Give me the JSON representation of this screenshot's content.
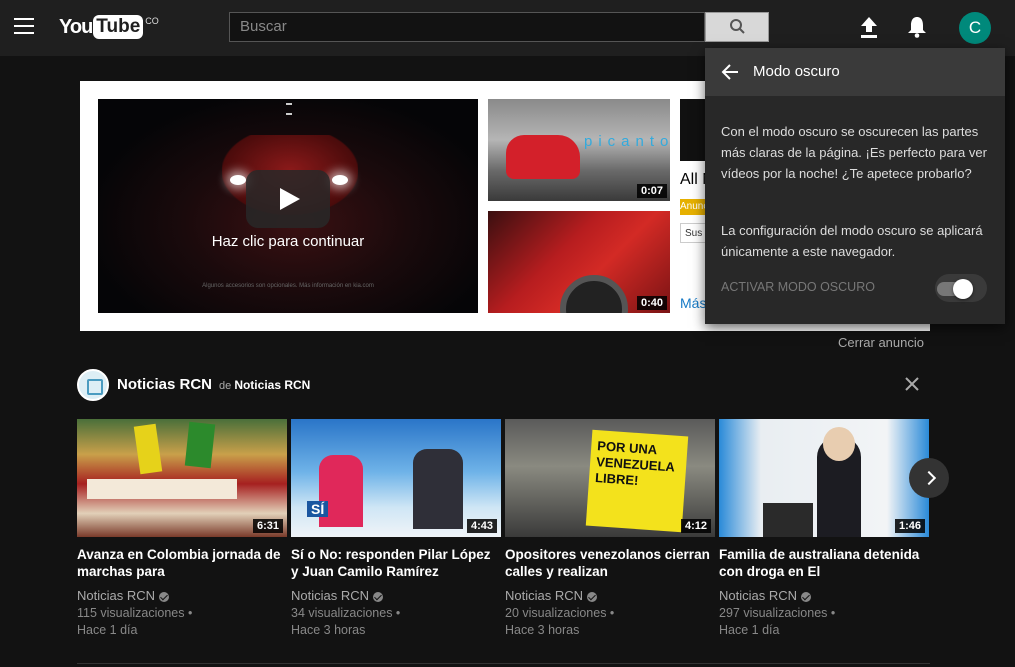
{
  "header": {
    "logo_you": "You",
    "logo_tube": "Tube",
    "logo_region": "CO",
    "search_placeholder": "Buscar",
    "avatar_letter": "C"
  },
  "ad": {
    "click_to_continue": "Haz clic para continuar",
    "fine_print": "Algunos accesorios son opcionales. Más información en kia.com",
    "thumb1_brand": "picanto",
    "thumb1_duration": "0:07",
    "thumb2_duration": "0:40",
    "side_title": "All N",
    "side_badge": "Anuncio",
    "side_subscribe": "Sus",
    "side_more": "Más",
    "close_ad": "Cerrar anuncio"
  },
  "shelf": {
    "channel_name": "Noticias RCN",
    "by_prefix": "de",
    "by_channel": "Noticias RCN",
    "videos": [
      {
        "title": "Avanza en Colombia jornada de marchas para",
        "channel": "Noticias RCN",
        "views": "115 visualizaciones •",
        "ago": "Hace 1 día",
        "duration": "6:31"
      },
      {
        "title": "Sí o No: responden Pilar López y Juan Camilo Ramírez",
        "channel": "Noticias RCN",
        "views": "34 visualizaciones •",
        "ago": "Hace 3 horas",
        "duration": "4:43"
      },
      {
        "title": "Opositores venezolanos cierran calles y realizan",
        "channel": "Noticias RCN",
        "views": "20 visualizaciones •",
        "ago": "Hace 3 horas",
        "duration": "4:12"
      },
      {
        "title": "Familia de australiana detenida con droga en El",
        "channel": "Noticias RCN",
        "views": "297 visualizaciones •",
        "ago": "Hace 1 día",
        "duration": "1:46"
      }
    ],
    "thumb2_label": "SÍ",
    "thumb3_banner": "POR UNA VENEZUELA LIBRE!"
  },
  "dark_mode_popup": {
    "title": "Modo oscuro",
    "paragraph1": "Con el modo oscuro se oscurecen las partes más claras de la página. ¡Es perfecto para ver vídeos por la noche! ¿Te apetece probarlo?",
    "paragraph2": "La configuración del modo oscuro se aplicará únicamente a este navegador.",
    "toggle_label": "ACTIVAR MODO OSCURO",
    "toggle_on": true
  },
  "colors": {
    "avatar": "#00897b",
    "link": "#167ac6",
    "badge": "#e6b000"
  }
}
